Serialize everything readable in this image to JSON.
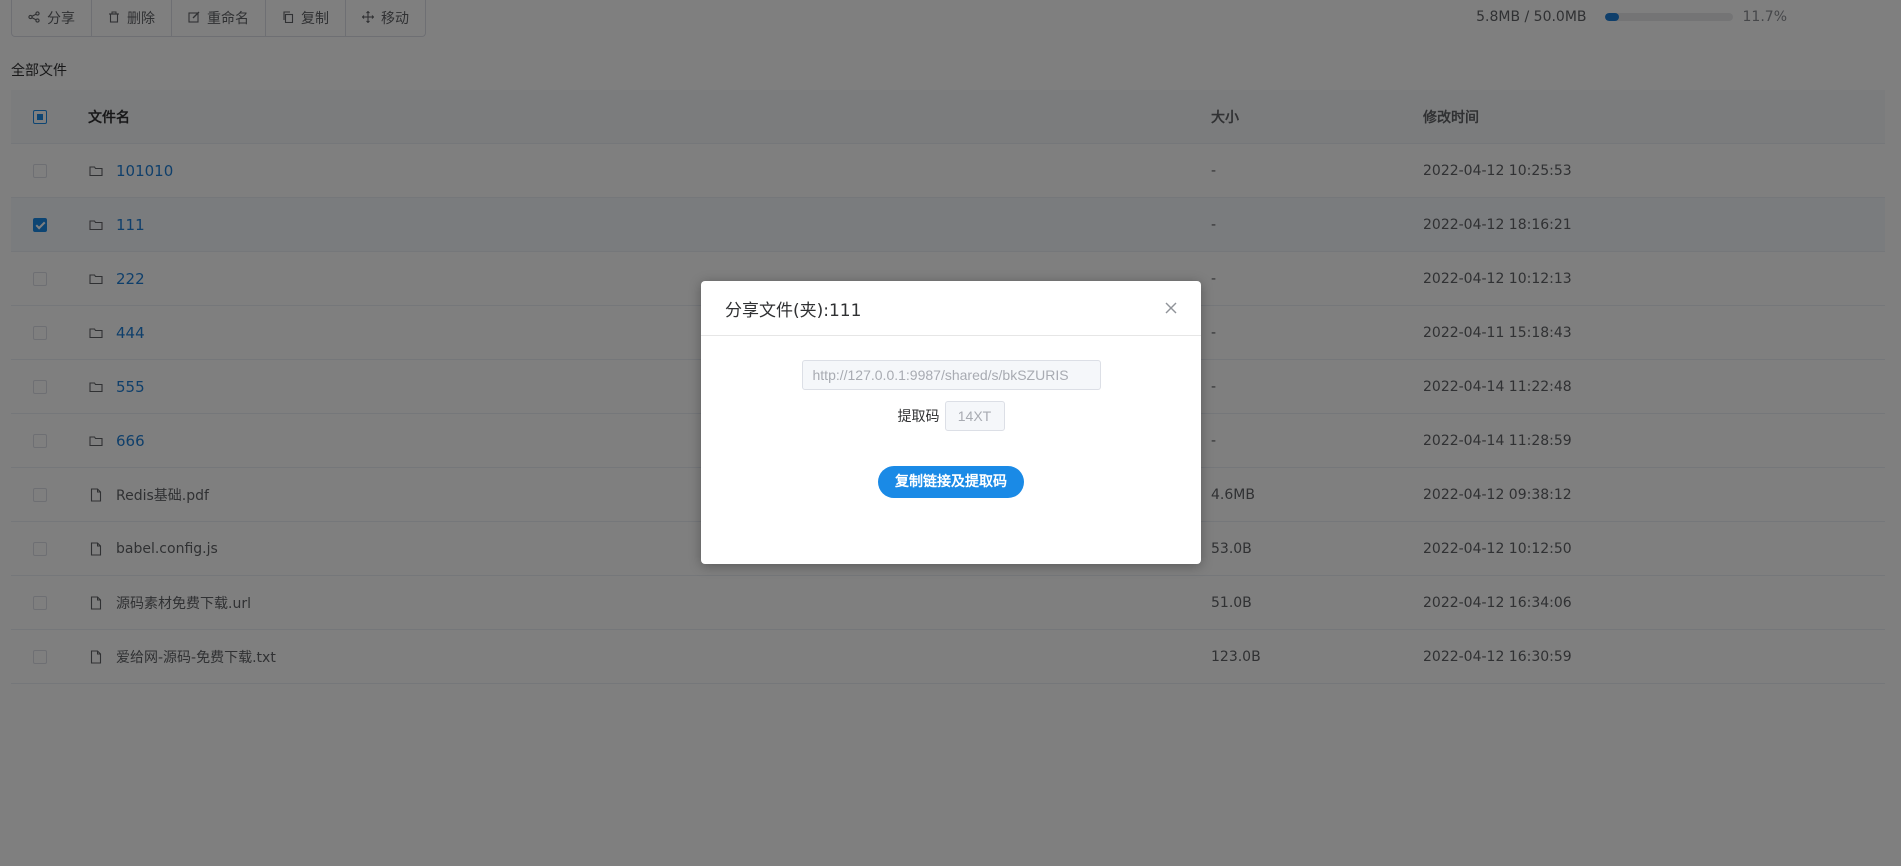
{
  "toolbar": {
    "buttons": [
      {
        "label": "分享",
        "icon": "share-icon"
      },
      {
        "label": "删除",
        "icon": "trash-icon"
      },
      {
        "label": "重命名",
        "icon": "edit-icon"
      },
      {
        "label": "复制",
        "icon": "copy-icon"
      },
      {
        "label": "移动",
        "icon": "move-icon"
      }
    ]
  },
  "storage": {
    "used_text": "5.8MB / 50.0MB",
    "percent_text": "11.7%",
    "percent_value": 11.7,
    "bar_color": "#1f7fd6"
  },
  "breadcrumb": "全部文件",
  "table": {
    "headers": {
      "name": "文件名",
      "size": "大小",
      "time": "修改时间"
    },
    "rows": [
      {
        "type": "folder",
        "name": "101010",
        "size": "-",
        "time": "2022-04-12 10:25:53",
        "checked": false
      },
      {
        "type": "folder",
        "name": "111",
        "size": "-",
        "time": "2022-04-12 18:16:21",
        "checked": true
      },
      {
        "type": "folder",
        "name": "222",
        "size": "-",
        "time": "2022-04-12 10:12:13",
        "checked": false
      },
      {
        "type": "folder",
        "name": "444",
        "size": "-",
        "time": "2022-04-11 15:18:43",
        "checked": false
      },
      {
        "type": "folder",
        "name": "555",
        "size": "-",
        "time": "2022-04-14 11:22:48",
        "checked": false
      },
      {
        "type": "folder",
        "name": "666",
        "size": "-",
        "time": "2022-04-14 11:28:59",
        "checked": false
      },
      {
        "type": "file",
        "name": "Redis基础.pdf",
        "size": "4.6MB",
        "time": "2022-04-12 09:38:12",
        "checked": false
      },
      {
        "type": "file",
        "name": "babel.config.js",
        "size": "53.0B",
        "time": "2022-04-12 10:12:50",
        "checked": false
      },
      {
        "type": "file",
        "name": "源码素材免费下载.url",
        "size": "51.0B",
        "time": "2022-04-12 16:34:06",
        "checked": false
      },
      {
        "type": "file",
        "name": "爱给网-源码-免费下载.txt",
        "size": "123.0B",
        "time": "2022-04-12 16:30:59",
        "checked": false
      }
    ]
  },
  "dialog": {
    "title": "分享文件(夹):111",
    "link_value": "http://127.0.0.1:9987/shared/s/bkSZURIS",
    "code_label": "提取码",
    "code_value": "14XT",
    "copy_button": "复制链接及提取码"
  },
  "colors": {
    "accent": "#1a8ae6",
    "link": "#1f7fd6"
  }
}
